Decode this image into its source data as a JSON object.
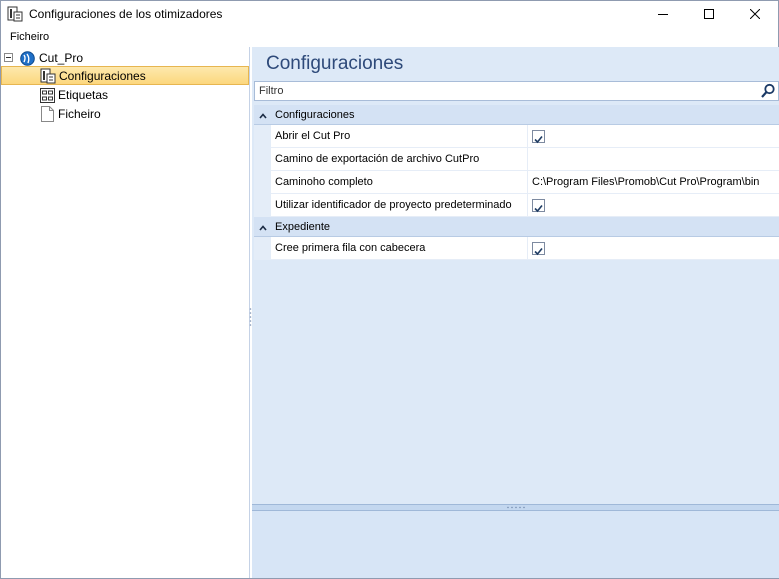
{
  "window": {
    "title": "Configuraciones de los otimizadores",
    "app_icon": "settings-document-icon",
    "controls": [
      "minimize-icon",
      "maximize-icon",
      "close-icon"
    ]
  },
  "menu": {
    "items": [
      "Ficheiro"
    ]
  },
  "tree": {
    "root": {
      "label": "Cut_Pro",
      "icon": "globe-icon",
      "expanded": true
    },
    "children": [
      {
        "label": "Configuraciones",
        "icon": "settings-document-icon",
        "selected": true
      },
      {
        "label": "Etiquetas",
        "icon": "label-sheet-icon",
        "selected": false
      },
      {
        "label": "Ficheiro",
        "icon": "blank-file-icon",
        "selected": false
      }
    ]
  },
  "content": {
    "title": "Configuraciones",
    "filter": {
      "placeholder": "Filtro",
      "icon": "search-icon"
    },
    "groups": [
      {
        "label": "Configuraciones",
        "expanded": true,
        "rows": [
          {
            "name": "Abrir el Cut Pro",
            "type": "checkbox",
            "checked": true,
            "value": ""
          },
          {
            "name": "Camino de exportación de archivo CutPro",
            "type": "text",
            "value": ""
          },
          {
            "name": "Caminoho completo",
            "type": "text",
            "value": "C:\\Program Files\\Promob\\Cut Pro\\Program\\bin"
          },
          {
            "name": "Utilizar identificador de proyecto predeterminado",
            "type": "checkbox",
            "checked": true,
            "value": ""
          }
        ]
      },
      {
        "label": "Expediente",
        "expanded": true,
        "rows": [
          {
            "name": "Cree primera fila con cabecera",
            "type": "checkbox",
            "checked": true,
            "value": ""
          }
        ]
      }
    ]
  },
  "colors": {
    "selection": "#fcd77e",
    "content_background": "#dde9f7",
    "title_text": "#2e4a7a"
  }
}
